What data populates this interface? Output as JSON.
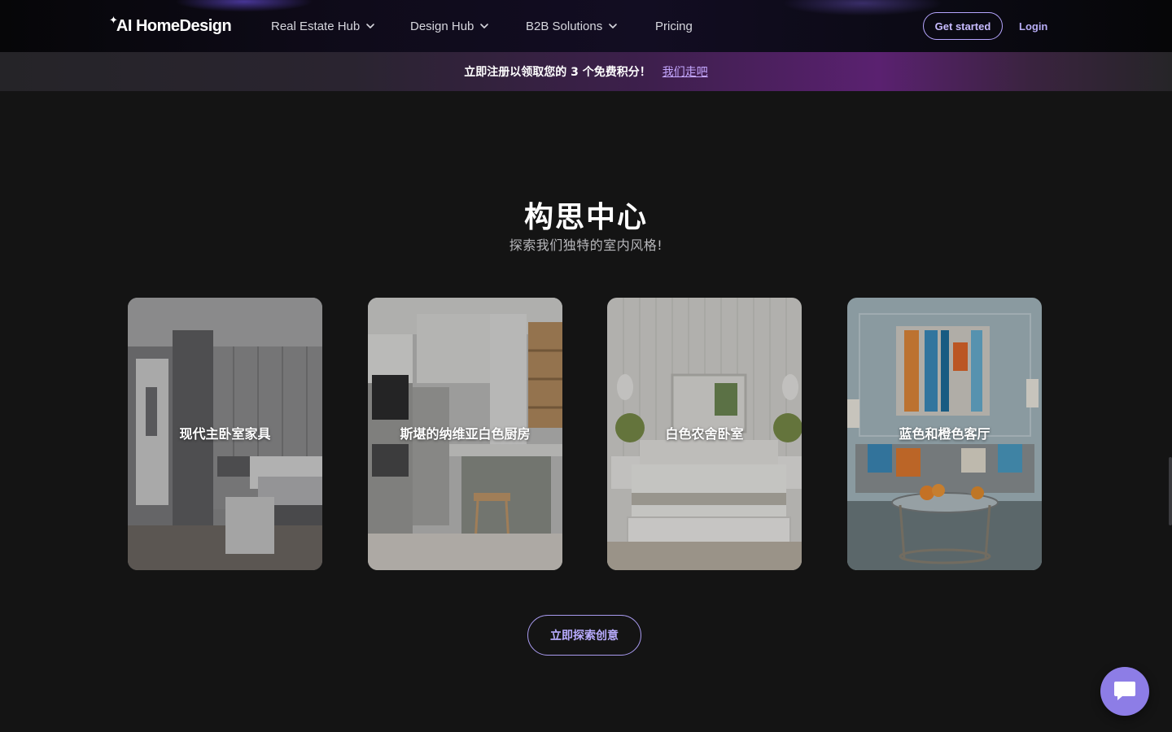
{
  "nav": {
    "brand": "AI HomeDesign",
    "items": [
      {
        "label": "Real Estate Hub",
        "has_dropdown": true
      },
      {
        "label": "Design Hub",
        "has_dropdown": true
      },
      {
        "label": "B2B Solutions",
        "has_dropdown": true
      },
      {
        "label": "Pricing",
        "has_dropdown": false
      }
    ],
    "get_started": "Get started",
    "login": "Login"
  },
  "promo": {
    "text": "立即注册以领取您的 3 个免费积分！",
    "link": "我们走吧"
  },
  "inspiration": {
    "title": "构思中心",
    "subtitle": "探索我们独特的室内风格!",
    "cards": [
      {
        "label": "现代主卧室家具"
      },
      {
        "label": "斯堪的纳维亚白色厨房"
      },
      {
        "label": "白色农舍卧室"
      },
      {
        "label": "蓝色和橙色客厅"
      }
    ],
    "explore_button": "立即探索创意"
  },
  "colors": {
    "background": "#141414",
    "accent": "#8d7de6",
    "accent_text": "#b9acff"
  },
  "icons": {
    "chevron": "chevron-down-icon",
    "chat": "chat-icon"
  }
}
